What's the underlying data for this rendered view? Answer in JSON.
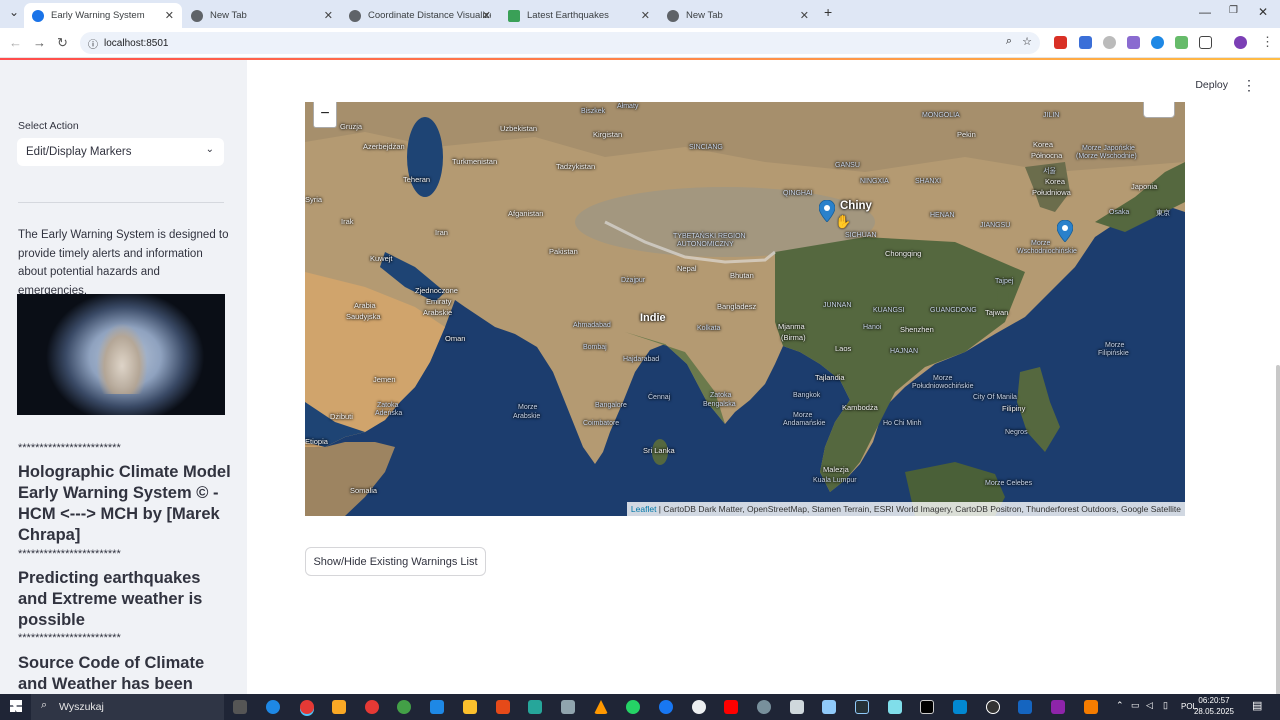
{
  "browser": {
    "tabs": [
      {
        "title": "Early Warning System",
        "active": true,
        "favicon_color": "#1a73e8"
      },
      {
        "title": "New Tab",
        "active": false,
        "favicon_color": "#5f6368"
      },
      {
        "title": "Coordinate Distance Visualizer",
        "active": false,
        "favicon_color": "#5f6368"
      },
      {
        "title": "Latest Earthquakes",
        "active": false,
        "favicon_color": "#3aa057"
      },
      {
        "title": "New Tab",
        "active": false,
        "favicon_color": "#5f6368"
      }
    ],
    "new_tab_symbol": "+",
    "url": "localhost:8501"
  },
  "sidebar": {
    "select_label": "Select Action",
    "select_value": "Edit/Display Markers",
    "description": "The Early Warning System is designed to provide timely alerts and information about potential hazards and emergencies.",
    "stars": "************************",
    "heading1": "Holographic Climate Model Early Warning System © - HCM <---> MCH by [Marek Chrapa]",
    "heading2": "Predicting earthquakes and Extreme weather is possible",
    "heading3": "Source Code of Climate and Weather has been found"
  },
  "header": {
    "deploy_label": "Deploy",
    "menu_symbol": "⋮"
  },
  "map": {
    "zoom_out_symbol": "−",
    "attribution_link": "Leaflet",
    "attribution_rest": " | CartoDB Dark Matter, OpenStreetMap, Stamen Terrain, ESRI World Imagery, CartoDB Positron, Thunderforest Outdoors, Google Satellite",
    "labels": {
      "gruzja": "Gruzja",
      "uzbekistan": "Uzbekistan",
      "kirgistan": "Kirgistan",
      "azerbejdzan": "Azerbejdżan",
      "turkmenistan": "Turkmenistan",
      "tadzykistan": "Tadżykistan",
      "teheran": "Teheran",
      "syria": "Syria",
      "afganistan": "Afganistan",
      "irak": "Irak",
      "iran": "Iran",
      "kuwejt": "Kuwejt",
      "pakistan": "Pakistan",
      "nepal": "Nepal",
      "bhutan": "Bhutan",
      "zjednoczone": "Zjednoczone",
      "emiraty": "Emiraty",
      "arabskie": "Arabskie",
      "arabia": "Arabia",
      "saudyjska": "Saudyjska",
      "oman": "Oman",
      "indie": "Indie",
      "bangladesz": "Bangladesz",
      "ahmadabad": "Ahmadabad",
      "kolkata": "Kolkata",
      "bombaj": "Bombaj",
      "hajdarabad": "Hajdarabad",
      "mjanma": "Mjanma",
      "birma": "(Birma)",
      "laos": "Laos",
      "hanoi": "Hanoi",
      "jemen": "Jemen",
      "bangalore": "Bangalore",
      "cennaj": "Ćennaj",
      "zatoka_bengalska1": "Zatoka",
      "zatoka_bengalska2": "Bengalska",
      "morze_arabskie1": "Morze",
      "morze_arabskie2": "Arabskie",
      "coimbatore": "Coimbatore",
      "srilanka": "Sri Lanka",
      "tajlandia": "Tajlandia",
      "bangkok": "Bangkok",
      "kambodza": "Kambodża",
      "hochiminh": "Ho Chi Minh",
      "dzibuti": "Dżibuti",
      "etiopia": "Etiopia",
      "somalia": "Somalia",
      "zatoka_adenska1": "Zatoka",
      "zatoka_adenska2": "Adeńska",
      "malezja": "Malezja",
      "kualalumpur": "Kuala Lumpur",
      "morze_andamanskie1": "Morze",
      "morze_andamanskie2": "Andamańskie",
      "chiny": "Chiny",
      "chongqing": "Chongqing",
      "shenzhen": "Shenzhen",
      "hajnan": "HAJNAN",
      "tajwan": "Tajwan",
      "tajpej": "Tajpej",
      "korea_pn1": "Korea",
      "korea_pn2": "Północna",
      "korea_pd1": "Korea",
      "korea_pd2": "Południowa",
      "japonia": "Japonia",
      "osaka": "Osaka",
      "tokio": "東京",
      "morze_japonskie1": "Morze Japońskie",
      "morze_japonskie2": "(Morze Wschodnie)",
      "morze_wsch1": "Morze",
      "morze_wsch2": "Wschodniochińskie",
      "morze_pd1": "Morze",
      "morze_pd2": "Południowochińskie",
      "filipiny": "Filipiny",
      "morze_fil1": "Morze",
      "morze_fil2": "Filipińskie",
      "cityofmanila": "City Of Manila",
      "morze_celebes": "Morze Celebes",
      "pekin": "Pekin",
      "mongolia": "MONGOLIA",
      "tybet1": "TYBETAŃSKI REGION",
      "tybet2": "AUTONOMICZNY",
      "qinghai": "QINGHAI",
      "sichuan": "SICHUAN",
      "junnan": "JUNNAN",
      "guangxi": "KUANGSI",
      "guangdong": "GUANGDONG",
      "henan": "HENAN",
      "jiangsu": "JIANGSU",
      "ningxia": "NINGXIA",
      "shanxi": "SHANXI",
      "xinjiang": "SINCIANG",
      "gansu": "GANSU",
      "almaty": "Ałmaty",
      "biszkek": "Biszkek",
      "jilin": "JILIN",
      "seul": "서울",
      "dzajpur": "Dżajpur",
      "negros": "Negros"
    }
  },
  "main": {
    "show_hide_button": "Show/Hide Existing Warnings List"
  },
  "taskbar": {
    "search_placeholder": "Wyszukaj",
    "language": "POL",
    "time": "06:20:57",
    "date": "28.05.2025"
  }
}
